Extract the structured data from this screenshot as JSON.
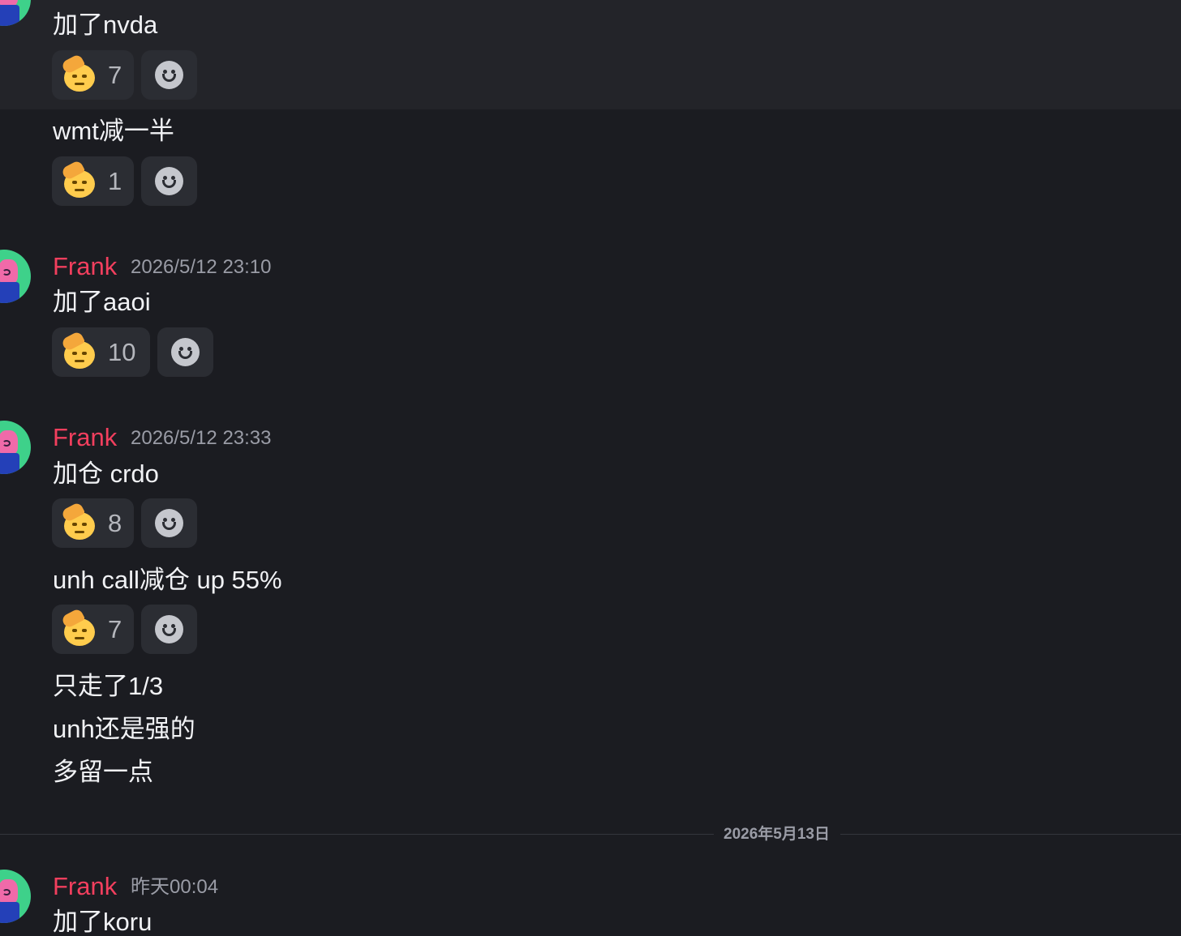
{
  "messages": [
    {
      "text": "加了nvda",
      "reaction_count": "7"
    },
    {
      "text": "wmt减一半",
      "reaction_count": "1"
    },
    {
      "author": "Frank",
      "time": "2026/5/12 23:10",
      "text": "加了aaoi",
      "reaction_count": "10"
    },
    {
      "author": "Frank",
      "time": "2026/5/12 23:33",
      "text": "加仓 crdo",
      "reaction_count": "8"
    },
    {
      "text": "unh call减仓 up 55%",
      "reaction_count": "7"
    },
    {
      "text": "只走了1/3"
    },
    {
      "text": "unh还是强的"
    },
    {
      "text": "多留一点"
    },
    {
      "author": "Frank",
      "time": "昨天00:04",
      "text": "加了koru"
    }
  ],
  "date_divider": "2026年5月13日",
  "colors": {
    "background": "#1b1c21",
    "author_name": "#f23f5e",
    "timestamp": "#9a9ca6",
    "reaction_bg": "#2b2d33"
  },
  "icons": {
    "reaction_emoji": "saluting-face-icon",
    "add_reaction": "add-reaction-smile-icon"
  }
}
